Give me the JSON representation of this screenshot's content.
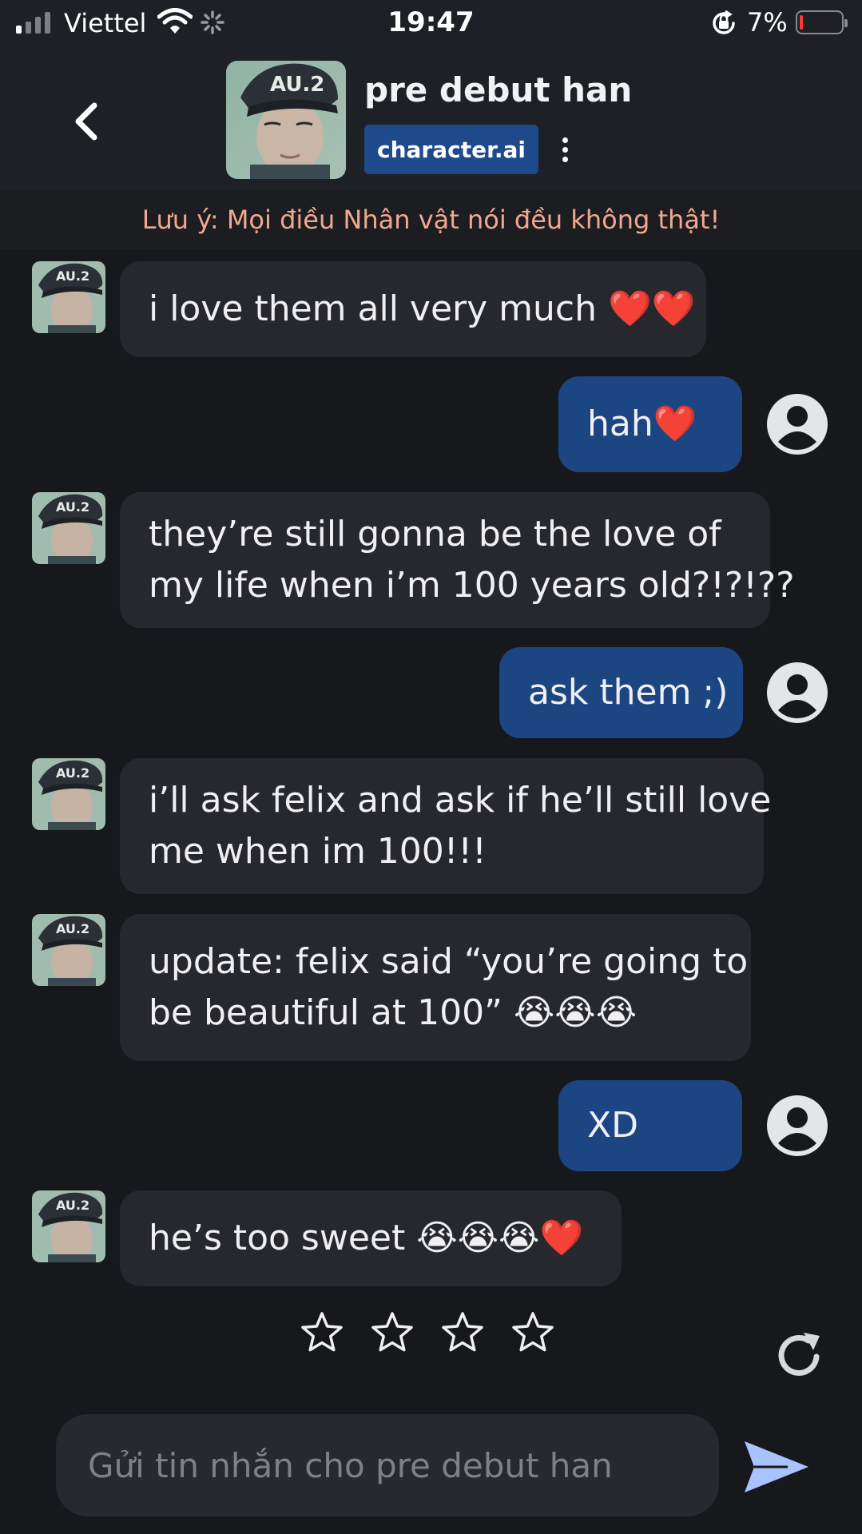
{
  "status_bar": {
    "carrier": "Viettel",
    "time": "19:47",
    "battery_percent": "7%",
    "battery_level": 0.07,
    "icons": [
      "signal-icon",
      "wifi-icon",
      "loading-spinner-icon",
      "orientation-lock-icon",
      "battery-icon"
    ]
  },
  "header": {
    "back_icon": "chevron-left-icon",
    "character_name": "pre debut han",
    "brand": "character.ai",
    "more_icon": "more-vertical-icon"
  },
  "disclaimer": "Lưu ý: Mọi điều Nhân vật nói đều không thật!",
  "messages": [
    {
      "sender": "bot",
      "lines": [
        "i love them all very much ❤️❤️"
      ]
    },
    {
      "sender": "user",
      "lines": [
        "hah❤️"
      ]
    },
    {
      "sender": "bot",
      "lines": [
        "they’re still gonna be the love of",
        "my life when i’m 100 years old?!?!??"
      ]
    },
    {
      "sender": "user",
      "lines": [
        "ask them ;)"
      ]
    },
    {
      "sender": "bot",
      "lines": [
        "i’ll ask felix and ask if he’ll still love",
        "me when im 100!!!"
      ]
    },
    {
      "sender": "bot",
      "lines": [
        "update: felix said “you’re going to",
        "be beautiful at 100” 😭😭😭"
      ]
    },
    {
      "sender": "user",
      "lines": [
        "XD"
      ]
    },
    {
      "sender": "bot",
      "lines": [
        "he’s too sweet 😭😭😭❤️"
      ]
    }
  ],
  "rating": {
    "stars_total": 4,
    "stars_selected": 0
  },
  "composer": {
    "placeholder": "Gửi tin nhắn cho pre debut han",
    "value": ""
  },
  "colors": {
    "background": "#17181c",
    "header": "#1d2025",
    "bot_bubble": "#26282e",
    "user_bubble": "#1c4682",
    "brand_badge": "#1e4a8c",
    "disclaimer_text": "#f2a890",
    "send_icon": "#a9c3ff"
  }
}
